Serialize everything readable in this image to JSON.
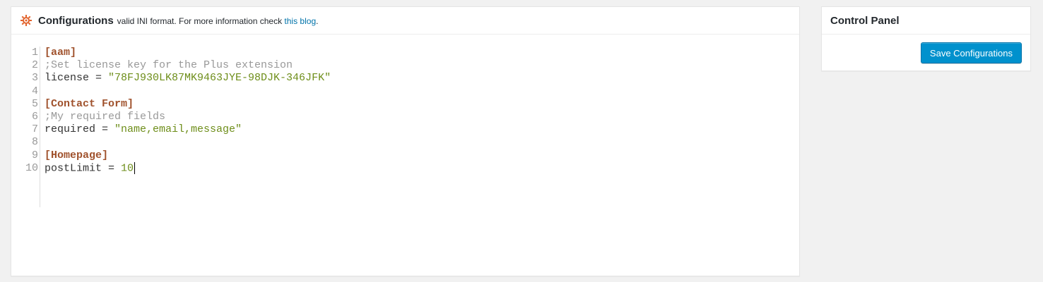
{
  "config": {
    "title": "Configurations",
    "description_prefix": "valid INI format. For more information check",
    "link_text": "this blog",
    "description_suffix": "."
  },
  "editor": {
    "line_numbers": [
      "1",
      "2",
      "3",
      "4",
      "5",
      "6",
      "7",
      "8",
      "9",
      "10"
    ],
    "lines": [
      [
        {
          "type": "section",
          "text": "[aam]"
        }
      ],
      [
        {
          "type": "comment",
          "text": ";Set license key for the Plus extension"
        }
      ],
      [
        {
          "type": "plain",
          "text": "license = "
        },
        {
          "type": "str",
          "text": "\"78FJ930LK87MK9463JYE-98DJK-346JFK\""
        }
      ],
      [],
      [
        {
          "type": "section",
          "text": "[Contact Form]"
        }
      ],
      [
        {
          "type": "comment",
          "text": ";My required fields"
        }
      ],
      [
        {
          "type": "plain",
          "text": "required = "
        },
        {
          "type": "str",
          "text": "\"name,email,message\""
        }
      ],
      [],
      [
        {
          "type": "section",
          "text": "[Homepage]"
        }
      ],
      [
        {
          "type": "plain",
          "text": "postLimit = "
        },
        {
          "type": "num",
          "text": "10"
        }
      ]
    ]
  },
  "control_panel": {
    "title": "Control Panel",
    "save_label": "Save Configurations"
  },
  "colors": {
    "accent": "#0091cd",
    "section": "#a0522d",
    "string": "#6e8e1a",
    "comment": "#999999",
    "gear": "#e2622b"
  },
  "icons": {
    "header": "gear-icon"
  }
}
